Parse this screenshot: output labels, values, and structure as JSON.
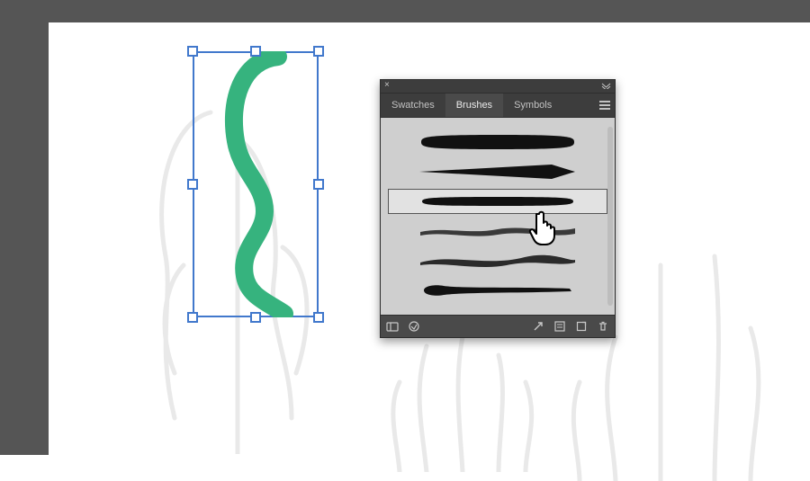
{
  "colors": {
    "stroke_green": "#36b37e",
    "selection_blue": "#4178cc",
    "panel_bg": "#4a4a4a"
  },
  "panel": {
    "tabs": [
      {
        "label": "Swatches",
        "active": false
      },
      {
        "label": "Brushes",
        "active": true
      },
      {
        "label": "Symbols",
        "active": false
      }
    ],
    "selected_brush_index": 2,
    "brush_count": 6
  },
  "footer_icons": {
    "library": "brush-libraries-icon",
    "libmenu": "library-menu-icon",
    "cut": "remove-stroke-icon",
    "options": "brush-options-icon",
    "new": "new-brush-icon",
    "trash": "delete-brush-icon"
  }
}
